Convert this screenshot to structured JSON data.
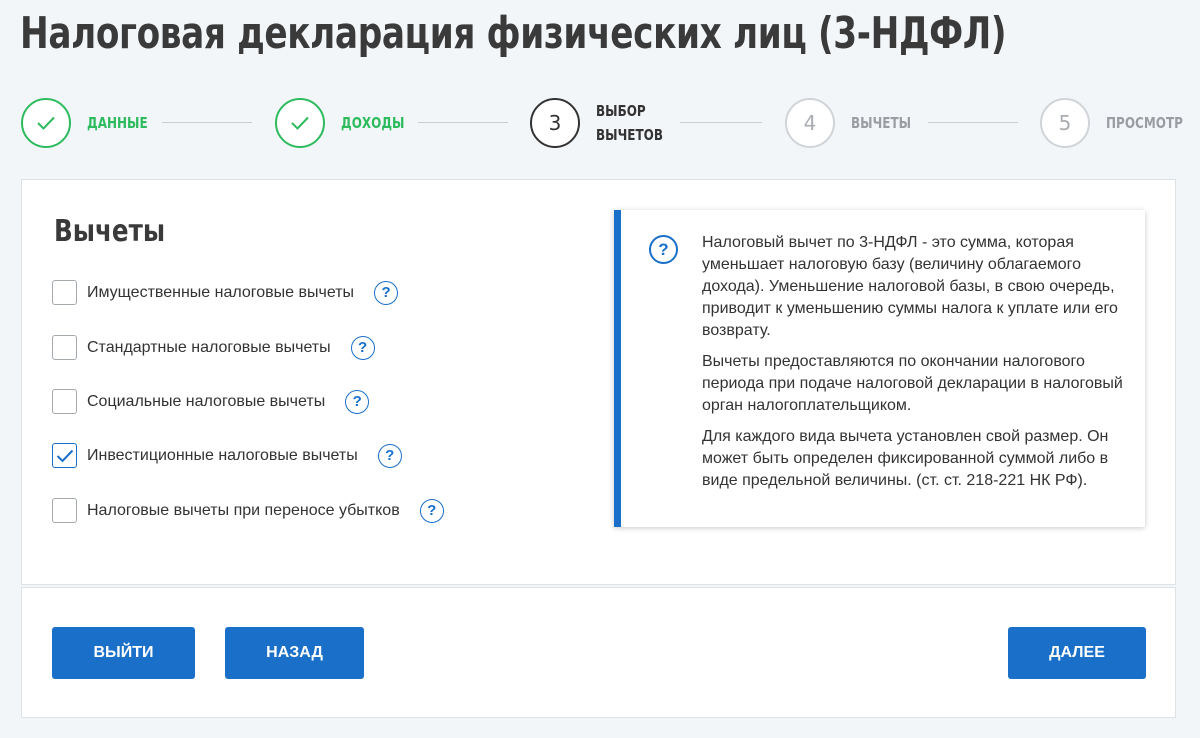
{
  "page": {
    "title": "Налоговая декларация физических лиц (3-НДФЛ)"
  },
  "stepper": {
    "steps": [
      {
        "number": "",
        "label": "ДАННЫЕ",
        "state": "done"
      },
      {
        "number": "",
        "label": "ДОХОДЫ",
        "state": "done"
      },
      {
        "number": "3",
        "label": "ВЫБОР\nВЫЧЕТОВ",
        "state": "active"
      },
      {
        "number": "4",
        "label": "ВЫЧЕТЫ",
        "state": "pending"
      },
      {
        "number": "5",
        "label": "ПРОСМОТР",
        "state": "pending"
      }
    ]
  },
  "deductions": {
    "title": "Вычеты",
    "options": [
      {
        "label": "Имущественные налоговые вычеты",
        "checked": false,
        "help": "?"
      },
      {
        "label": "Стандартные налоговые вычеты",
        "checked": false,
        "help": "?"
      },
      {
        "label": "Социальные налоговые вычеты",
        "checked": false,
        "help": "?"
      },
      {
        "label": "Инвестиционные налоговые вычеты",
        "checked": true,
        "help": "?"
      },
      {
        "label": "Налоговые вычеты при переносе убытков",
        "checked": false,
        "help": "?"
      }
    ]
  },
  "info": {
    "icon": "question-circle-icon",
    "icon_glyph": "?",
    "paragraphs": [
      "Налоговый вычет по 3-НДФЛ - это сумма, которая уменьшает налоговую базу (величину облагаемого дохода). Уменьшение налоговой базы, в свою очередь, приводит к уменьшению суммы налога к уплате или его возврату.",
      "Вычеты предоставляются по окончании налогового периода при подаче налоговой декларации в налоговый орган налогоплательщиком.",
      "Для каждого вида вычета установлен свой размер. Он может быть определен фиксированной суммой либо в виде предельной величины. (ст. ст. 218-221 НК РФ)."
    ]
  },
  "footer": {
    "exit_label": "ВЫЙТИ",
    "back_label": "НАЗАД",
    "next_label": "ДАЛЕЕ"
  },
  "colors": {
    "accent": "#1a6fc9",
    "success": "#2dbb5d",
    "background": "#f3f6f9"
  }
}
